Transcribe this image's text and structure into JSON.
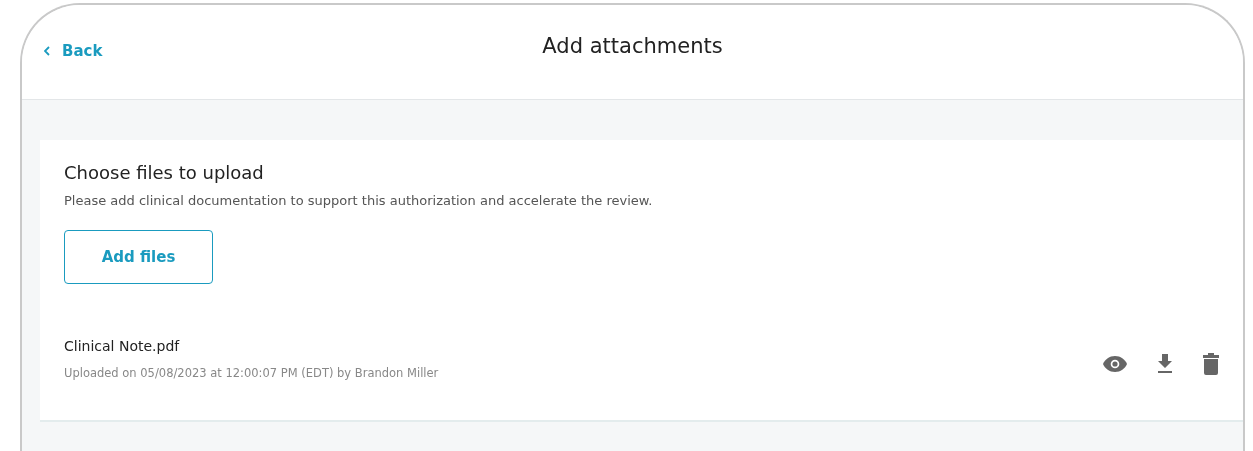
{
  "header": {
    "back_label": "Back",
    "title": "Add attachments"
  },
  "upload": {
    "heading": "Choose files to upload",
    "description": "Please add clinical documentation to support this authorization and accelerate the review.",
    "add_button": "Add files"
  },
  "files": [
    {
      "name": "Clinical Note.pdf",
      "meta": "Uploaded on 05/08/2023 at 12:00:07 PM (EDT) by Brandon Miller"
    }
  ]
}
